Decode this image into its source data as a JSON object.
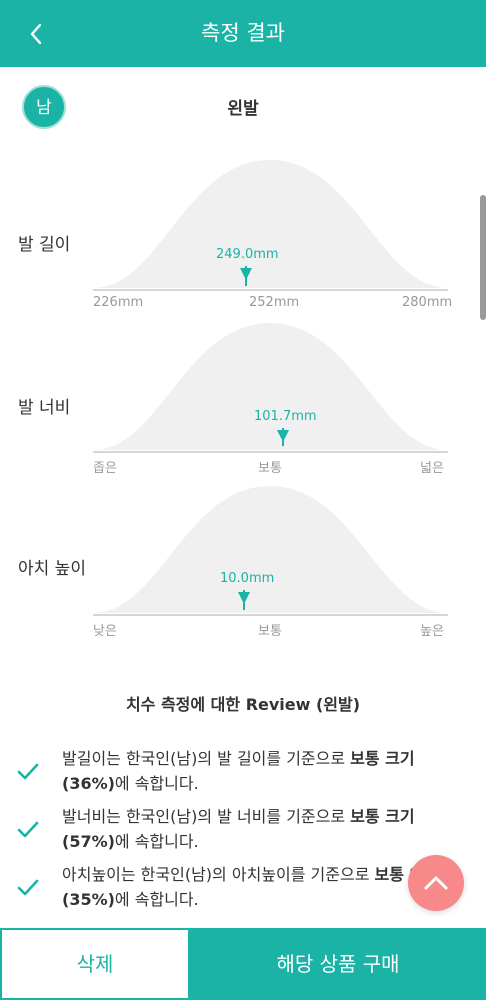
{
  "header": {
    "title": "측정 결과",
    "back_icon": "chevron-left-icon"
  },
  "gender_badge": "남",
  "foot_side": "왼발",
  "metrics": [
    {
      "label": "발 길이",
      "value_label": "249.0mm",
      "scale": [
        "226mm",
        "252mm",
        "280mm"
      ],
      "position_fraction": 0.43
    },
    {
      "label": "발 너비",
      "value_label": "101.7mm",
      "scale": [
        "좁은",
        "보통",
        "넓은"
      ],
      "position_fraction": 0.57
    },
    {
      "label": "아치 높이",
      "value_label": "10.0mm",
      "scale": [
        "낮은",
        "보통",
        "높은"
      ],
      "position_fraction": 0.43
    }
  ],
  "review": {
    "title": "치수 측정에 대한 Review (왼발)",
    "items": [
      {
        "pre": "발길이는 한국인(남)의 발 길이를 기준으로 ",
        "bold": "보통 크기(36%)",
        "post": "에 속합니다."
      },
      {
        "pre": "발너비는 한국인(남)의 발 너비를 기준으로 ",
        "bold": "보통 크기(57%)",
        "post": "에 속합니다."
      },
      {
        "pre": "아치높이는 한국인(남)의 아치높이를 기준으로 ",
        "bold": "보통 아치(35%)",
        "post": "에 속합니다."
      }
    ]
  },
  "fab_icon": "chevron-up-icon",
  "buttons": {
    "delete": "삭제",
    "buy": "해당 상품 구매"
  },
  "colors": {
    "primary": "#1ab3a6",
    "fab": "#f8898b",
    "curve": "#f0f0f0"
  }
}
